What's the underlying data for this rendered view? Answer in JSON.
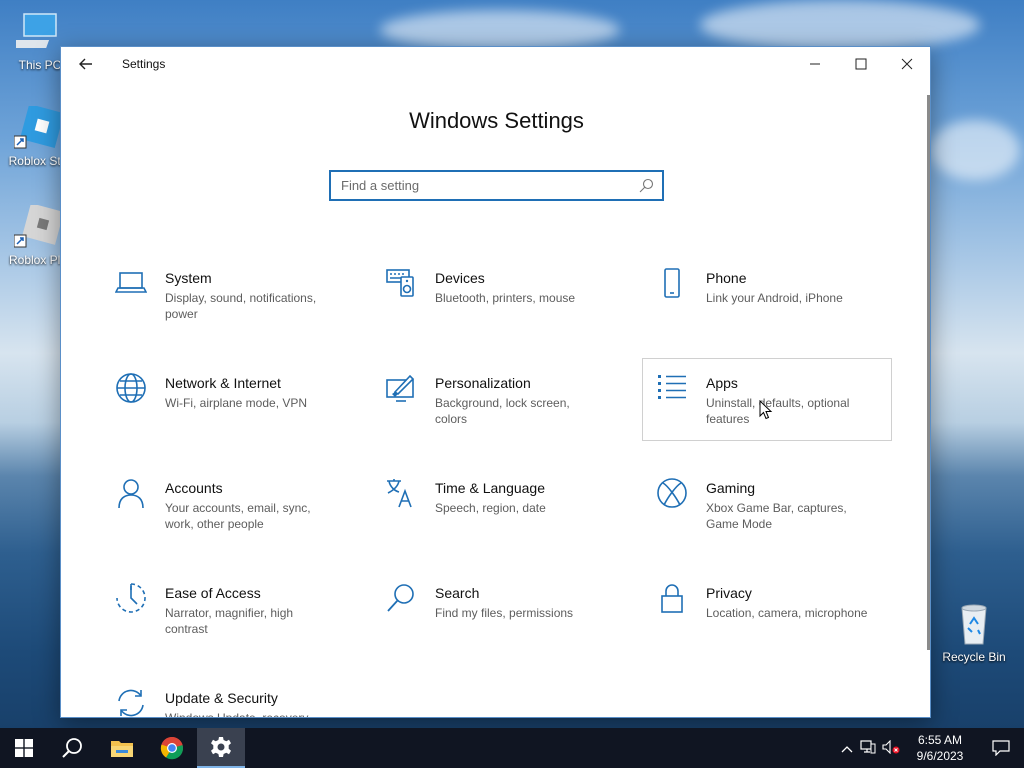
{
  "desktop": {
    "icons": [
      {
        "label": "This PC"
      },
      {
        "label": "Roblox Stu"
      },
      {
        "label": "Roblox Pla"
      },
      {
        "label": "Recycle Bin"
      }
    ]
  },
  "window": {
    "title": "Settings",
    "heading": "Windows Settings",
    "search": {
      "placeholder": "Find a setting",
      "value": ""
    }
  },
  "tiles": [
    {
      "name": "System",
      "desc": "Display, sound, notifications, power",
      "icon": "laptop-icon"
    },
    {
      "name": "Devices",
      "desc": "Bluetooth, printers, mouse",
      "icon": "devices-icon"
    },
    {
      "name": "Phone",
      "desc": "Link your Android, iPhone",
      "icon": "phone-icon"
    },
    {
      "name": "Network & Internet",
      "desc": "Wi-Fi, airplane mode, VPN",
      "icon": "globe-icon"
    },
    {
      "name": "Personalization",
      "desc": "Background, lock screen, colors",
      "icon": "paintbrush-icon"
    },
    {
      "name": "Apps",
      "desc": "Uninstall, defaults, optional features",
      "icon": "apps-list-icon"
    },
    {
      "name": "Accounts",
      "desc": "Your accounts, email, sync, work, other people",
      "icon": "person-icon"
    },
    {
      "name": "Time & Language",
      "desc": "Speech, region, date",
      "icon": "time-language-icon"
    },
    {
      "name": "Gaming",
      "desc": "Xbox Game Bar, captures, Game Mode",
      "icon": "xbox-icon"
    },
    {
      "name": "Ease of Access",
      "desc": "Narrator, magnifier, high contrast",
      "icon": "ease-of-access-icon"
    },
    {
      "name": "Search",
      "desc": "Find my files, permissions",
      "icon": "search-icon"
    },
    {
      "name": "Privacy",
      "desc": "Location, camera, microphone",
      "icon": "lock-icon"
    },
    {
      "name": "Update & Security",
      "desc": "Windows Update, recovery",
      "icon": "sync-icon"
    }
  ],
  "taskbar": {
    "time": "6:55 AM",
    "date": "9/6/2023"
  },
  "colors": {
    "accent": "#1f6fb5",
    "taskbar": "#101522"
  }
}
